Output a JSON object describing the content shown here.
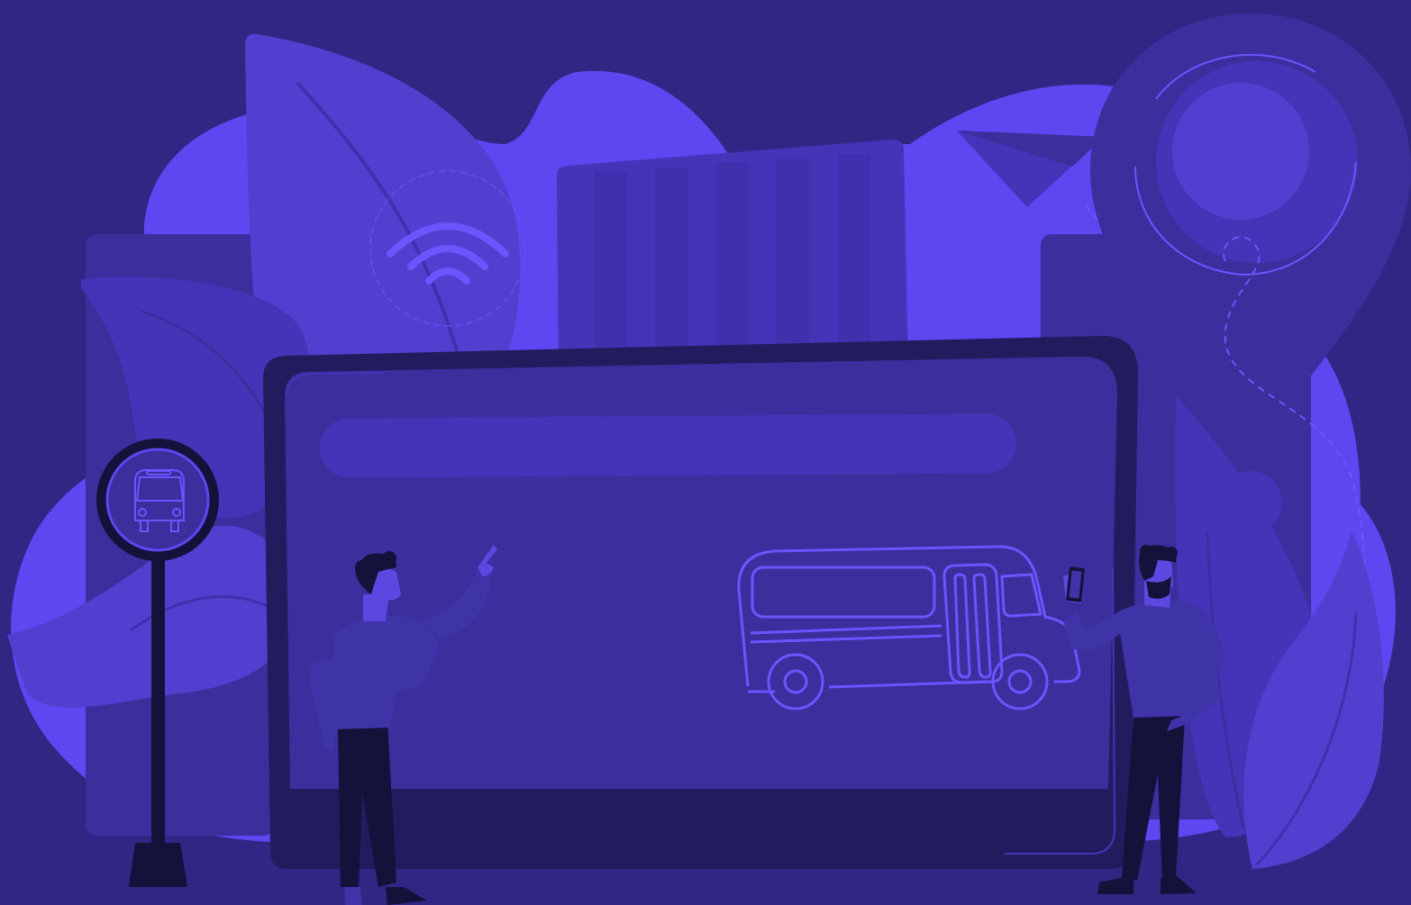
{
  "illustration": {
    "colors": {
      "background": "#2f2783",
      "blob_bright": "#5c47f0",
      "panel_mid": "#4434b8",
      "panel_dark": "#3b2f9e",
      "frame_dark": "#221c5e",
      "leaf": "#5140d0",
      "line_accent": "#6a55ff",
      "figure_dark": "#14113a",
      "figure_shirt": "#3f33a8",
      "skin": "#5a48e0"
    },
    "icons": [
      "wifi-icon",
      "paper-plane-icon",
      "location-pin-icon",
      "bus-stop-sign-icon",
      "bus-icon",
      "smartphone-icon"
    ],
    "figures": [
      "person-pointing",
      "person-holding-phone"
    ]
  }
}
